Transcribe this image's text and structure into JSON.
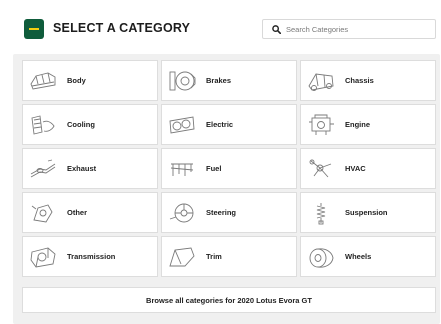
{
  "header": {
    "title": "SELECT A CATEGORY",
    "menu_icon": "menu-icon",
    "search": {
      "placeholder": "Search Categories",
      "value": "",
      "icon": "search-icon"
    }
  },
  "categories": [
    {
      "label": "Body"
    },
    {
      "label": "Brakes"
    },
    {
      "label": "Chassis"
    },
    {
      "label": "Cooling"
    },
    {
      "label": "Electric"
    },
    {
      "label": "Engine"
    },
    {
      "label": "Exhaust"
    },
    {
      "label": "Fuel"
    },
    {
      "label": "HVAC"
    },
    {
      "label": "Other"
    },
    {
      "label": "Steering"
    },
    {
      "label": "Suspension"
    },
    {
      "label": "Transmission"
    },
    {
      "label": "Trim"
    },
    {
      "label": "Wheels"
    }
  ],
  "browse_all_label": "Browse all categories for 2020 Lotus Evora GT",
  "colors": {
    "accent_green": "#0f5c3b",
    "accent_yellow": "#f3ce11",
    "panel_bg": "#f0f0f0"
  }
}
